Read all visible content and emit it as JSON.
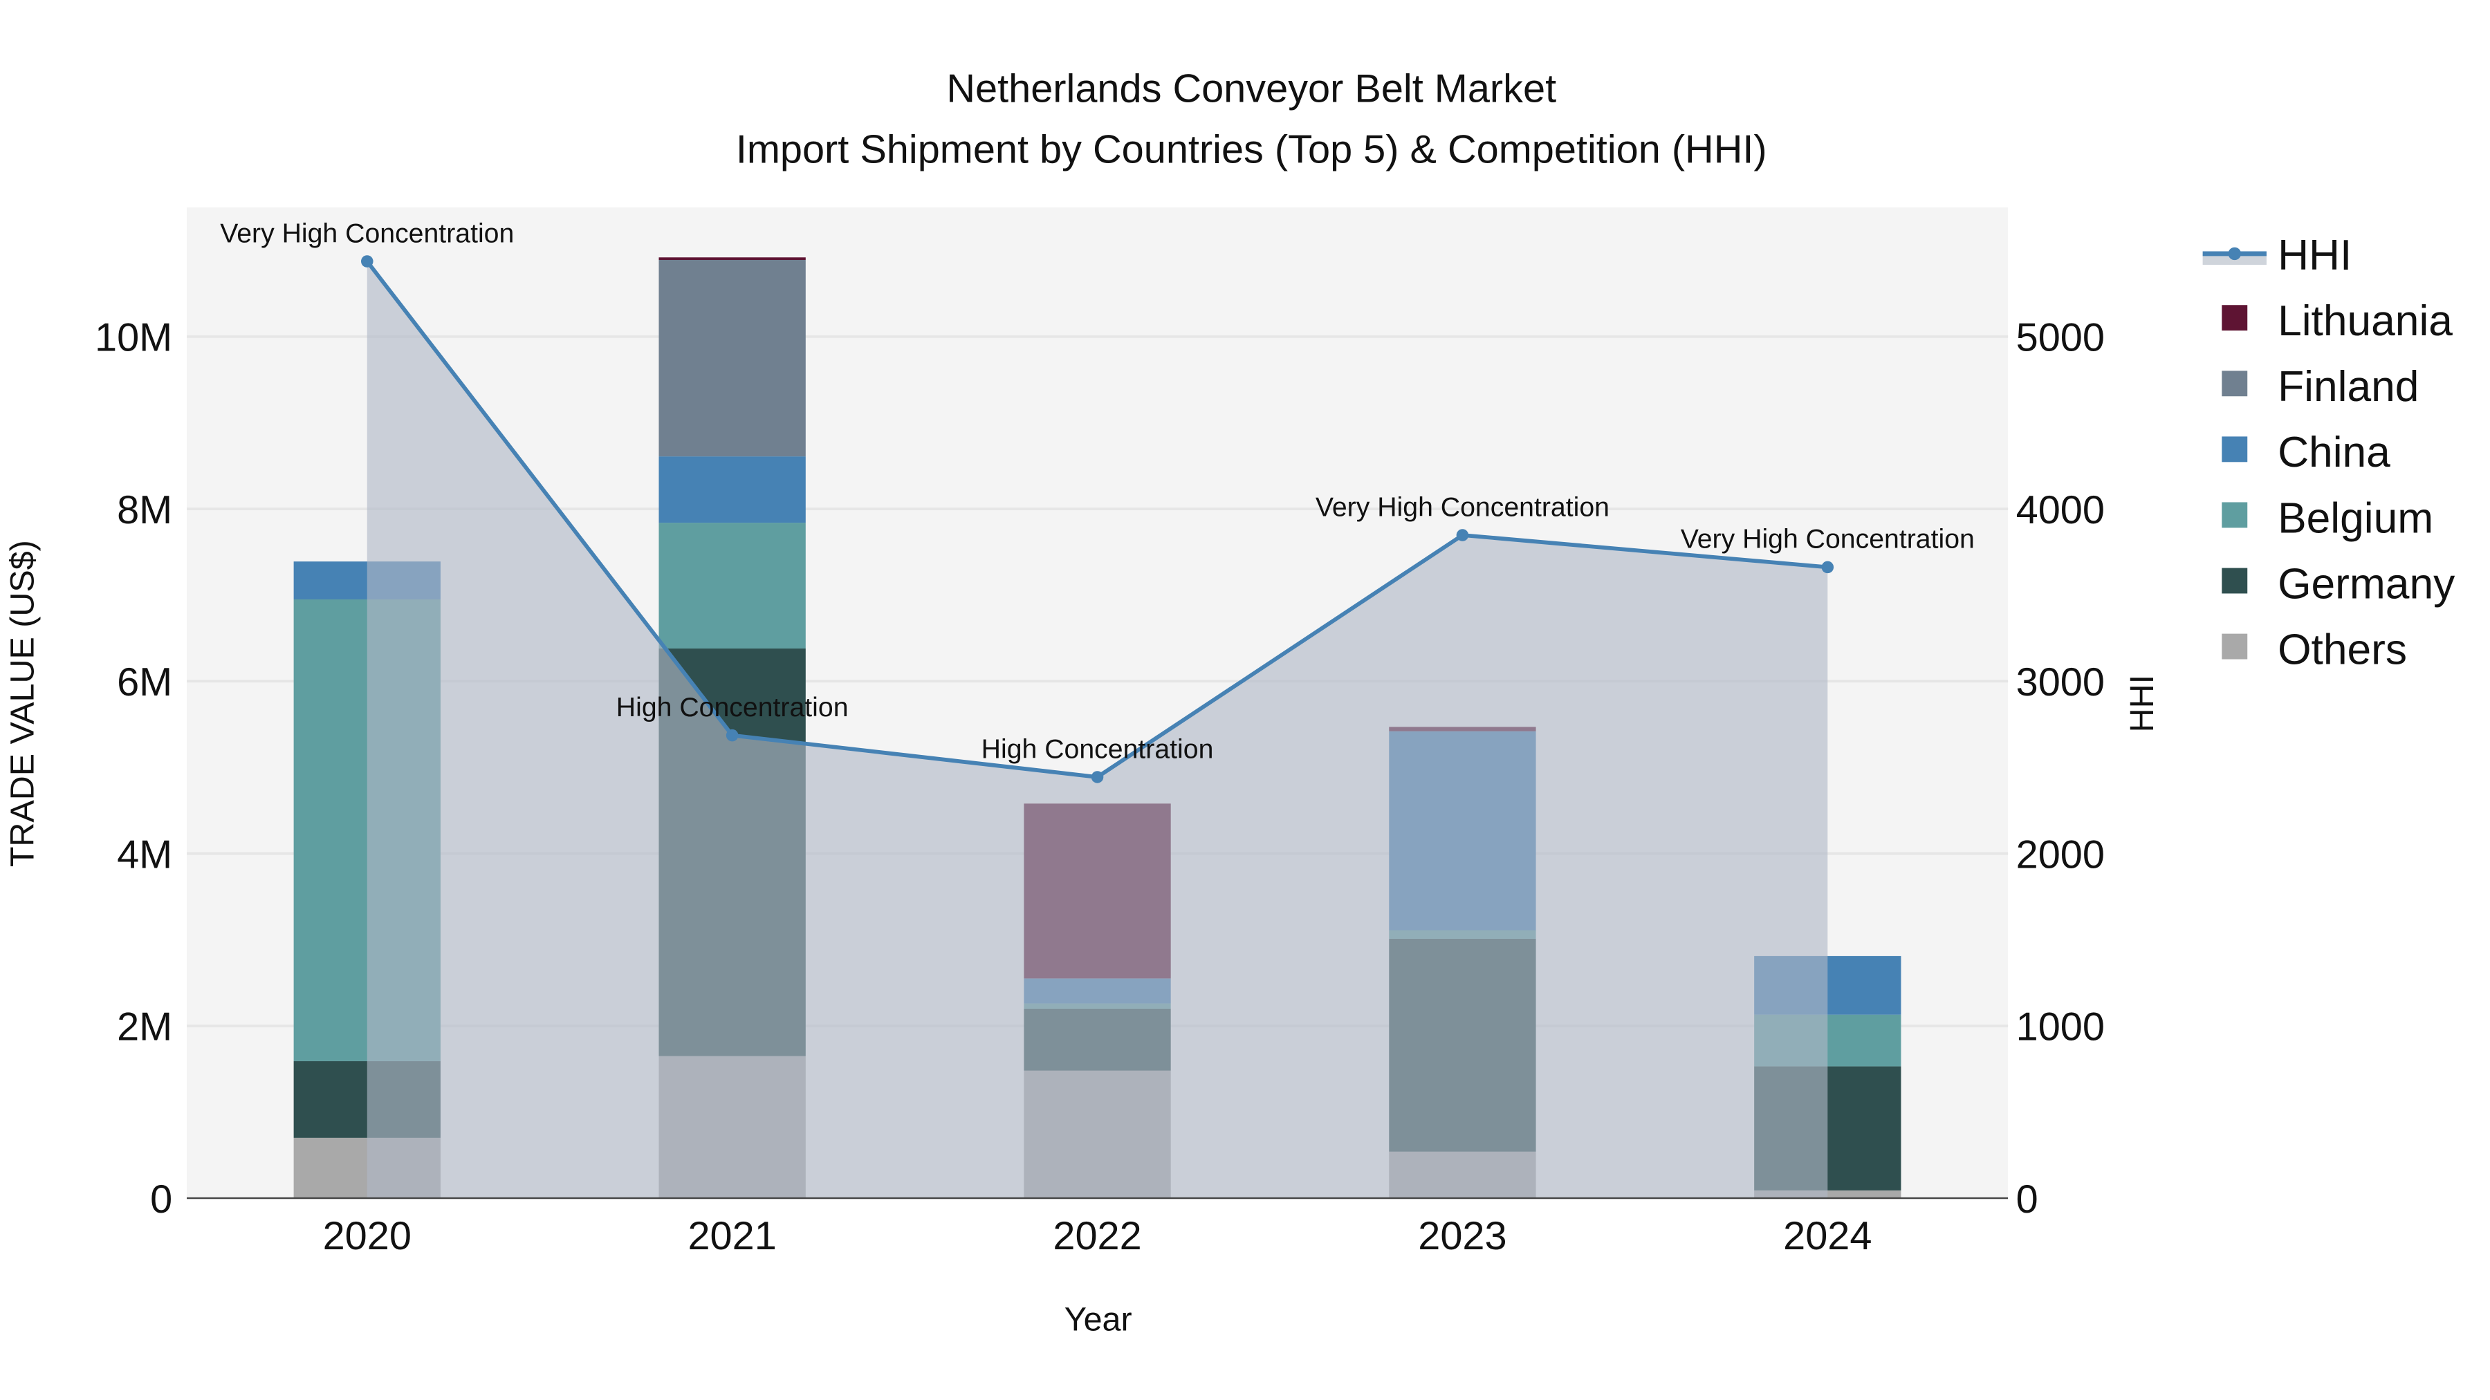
{
  "chart_data": {
    "type": "bar",
    "title": "Netherlands Conveyor Belt Market",
    "subtitle": "Import Shipment by Countries (Top 5) & Competition (HHI)",
    "xlabel": "Year",
    "ylabel": "TRADE VALUE (US$)",
    "y2label": "HHI",
    "categories": [
      "2020",
      "2021",
      "2022",
      "2023",
      "2024"
    ],
    "ylim": [
      0,
      11500000
    ],
    "y2lim": [
      0,
      5750
    ],
    "yticks": [
      0,
      2000000,
      4000000,
      6000000,
      8000000,
      10000000
    ],
    "ytick_labels": [
      "0",
      "2M",
      "4M",
      "6M",
      "8M",
      "10M"
    ],
    "y2ticks": [
      0,
      1000,
      2000,
      3000,
      4000,
      5000
    ],
    "y2tick_labels": [
      "0",
      "1000",
      "2000",
      "3000",
      "4000",
      "5000"
    ],
    "grid": true,
    "legend_position": "right",
    "series": [
      {
        "name": "Others",
        "color": "#a9a9a9",
        "values": [
          700000,
          1650000,
          1480000,
          540000,
          90000
        ]
      },
      {
        "name": "Germany",
        "color": "#2f4f4f",
        "values": [
          890000,
          4730000,
          720000,
          2470000,
          1440000
        ]
      },
      {
        "name": "Belgium",
        "color": "#5f9ea0",
        "values": [
          5360000,
          1460000,
          60000,
          100000,
          600000
        ]
      },
      {
        "name": "China",
        "color": "#4682b4",
        "values": [
          440000,
          770000,
          290000,
          2310000,
          680000
        ]
      },
      {
        "name": "Finland",
        "color": "#708090",
        "values": [
          0,
          2280000,
          0,
          0,
          0
        ]
      },
      {
        "name": "Lithuania",
        "color": "#5e1433",
        "values": [
          0,
          30000,
          2030000,
          50000,
          0
        ]
      }
    ],
    "hhi": {
      "name": "HHI",
      "color": "#4682b4",
      "values": [
        5437,
        2686,
        2444,
        3848,
        3662
      ],
      "annotations": [
        "Very High Concentration",
        "High Concentration",
        "High Concentration",
        "Very High Concentration",
        "Very High Concentration"
      ]
    },
    "legend": [
      "HHI",
      "Lithuania",
      "Finland",
      "China",
      "Belgium",
      "Germany",
      "Others"
    ]
  }
}
